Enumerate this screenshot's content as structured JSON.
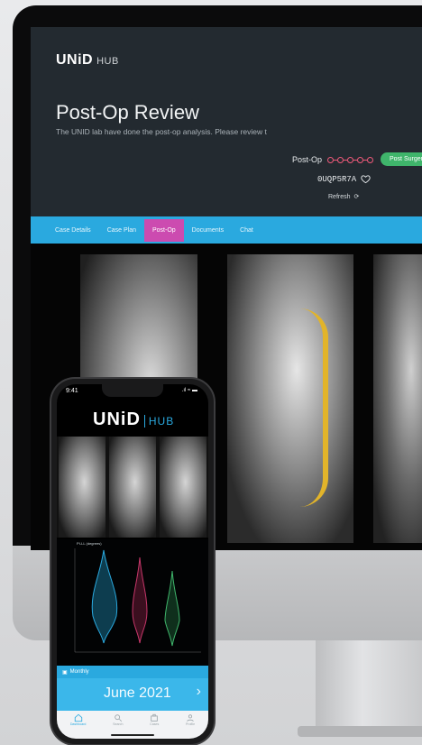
{
  "desktop": {
    "brand": {
      "name": "UNiD",
      "suffix": "HUB"
    },
    "title": "Post-Op Review",
    "subtitle": "The UNID lab have done the post-op analysis. Please review t",
    "status": {
      "label": "Post-Op",
      "pill": "Post Surgery",
      "pill_color": "#3fb56b"
    },
    "case_id": "0UQP5R7A",
    "refresh_label": "Refresh",
    "nav": {
      "tabs": [
        "Case Details",
        "Case Plan",
        "Post-Op",
        "Documents",
        "Chat"
      ],
      "active": "Post-Op"
    },
    "colors": {
      "nav": "#2aa9df",
      "active_tab": "#cc4bb0",
      "header": "#232a30",
      "accent": "#ef5a7a"
    }
  },
  "phone": {
    "time": "9:41",
    "status_icons": ".ıl ≈ ▬",
    "brand": {
      "name": "UNiD",
      "suffix": "HUB"
    },
    "plot_title": "PI-LL (degrees)",
    "monthly_label": "Monthly",
    "month": "June 2021",
    "next_icon": "chevron-right-icon",
    "tabs": [
      {
        "label": "Dashboard",
        "icon": "home-icon",
        "active": true
      },
      {
        "label": "Search",
        "icon": "search-icon",
        "active": false
      },
      {
        "label": "Cases",
        "icon": "briefcase-icon",
        "active": false
      },
      {
        "label": "Profile",
        "icon": "person-icon",
        "active": false
      }
    ]
  }
}
